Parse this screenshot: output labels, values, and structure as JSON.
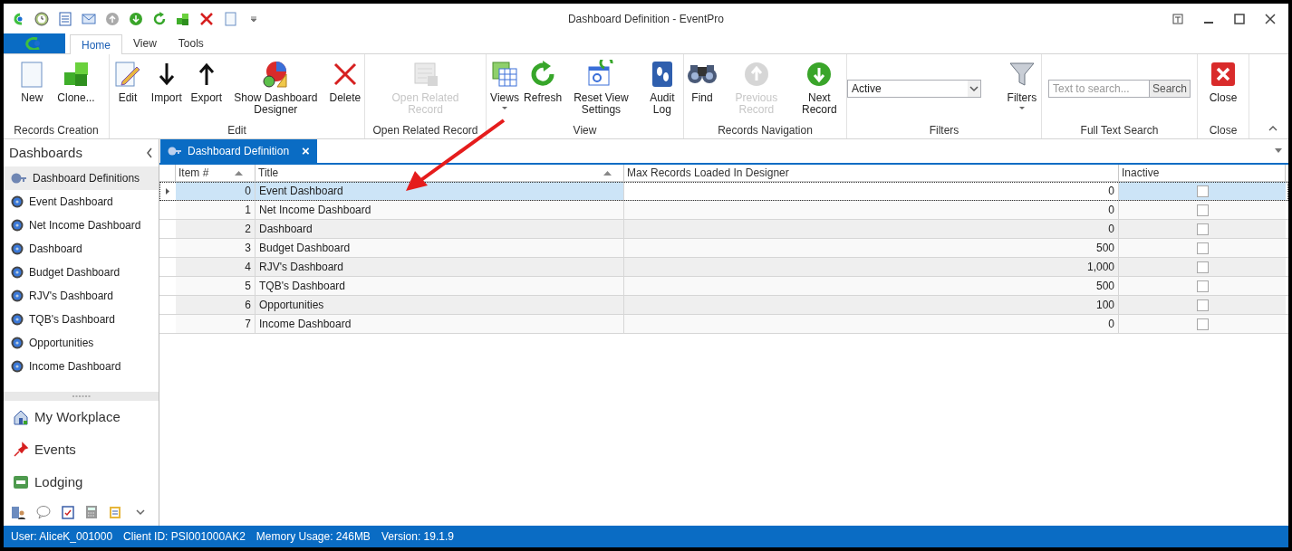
{
  "window": {
    "title": "Dashboard Definition - EventPro"
  },
  "ribbon_tabs": [
    {
      "label": "Home",
      "selected": true
    },
    {
      "label": "View",
      "selected": false
    },
    {
      "label": "Tools",
      "selected": false
    }
  ],
  "ribbon_groups": [
    {
      "label": "Records Creation",
      "buttons": [
        {
          "label": "New",
          "disabled": false
        },
        {
          "label": "Clone...",
          "disabled": false
        }
      ]
    },
    {
      "label": "Edit",
      "buttons": [
        {
          "label": "Edit",
          "disabled": false
        },
        {
          "label": "Import",
          "disabled": false
        },
        {
          "label": "Export",
          "disabled": false
        },
        {
          "label": "Show Dashboard Designer",
          "disabled": false
        },
        {
          "label": "Delete",
          "disabled": false
        }
      ]
    },
    {
      "label": "Open Related Record",
      "buttons": [
        {
          "label": "Open Related Record",
          "disabled": true
        }
      ]
    },
    {
      "label": "View",
      "buttons": [
        {
          "label": "Views",
          "disabled": false,
          "dropdown": true
        },
        {
          "label": "Refresh",
          "disabled": false
        },
        {
          "label": "Reset View Settings",
          "disabled": false
        },
        {
          "label": "Audit Log",
          "disabled": false
        }
      ]
    },
    {
      "label": "Records Navigation",
      "buttons": [
        {
          "label": "Find",
          "disabled": false
        },
        {
          "label": "Previous Record",
          "disabled": true
        },
        {
          "label": "Next Record",
          "disabled": false
        }
      ]
    },
    {
      "label": "Filters",
      "filter_value": "Active",
      "buttons": [
        {
          "label": "Filters",
          "disabled": false,
          "dropdown": true
        }
      ]
    },
    {
      "label": "Full Text Search",
      "search": {
        "placeholder": "Text to search...",
        "button": "Search"
      }
    },
    {
      "label": "Close",
      "buttons": [
        {
          "label": "Close",
          "disabled": false
        }
      ]
    }
  ],
  "sidebar": {
    "title": "Dashboards",
    "items": [
      {
        "label": "Dashboard Definitions",
        "selected": true
      },
      {
        "label": "Event Dashboard",
        "selected": false
      },
      {
        "label": "Net Income Dashboard",
        "selected": false
      },
      {
        "label": "Dashboard",
        "selected": false
      },
      {
        "label": "Budget Dashboard",
        "selected": false
      },
      {
        "label": "RJV's Dashboard",
        "selected": false
      },
      {
        "label": "TQB's Dashboard",
        "selected": false
      },
      {
        "label": "Opportunities",
        "selected": false
      },
      {
        "label": "Income Dashboard",
        "selected": false
      }
    ],
    "nav": [
      {
        "label": "My Workplace"
      },
      {
        "label": "Events"
      },
      {
        "label": "Lodging"
      }
    ]
  },
  "document_tab": {
    "label": "Dashboard Definition",
    "close": "×"
  },
  "table": {
    "columns": [
      "Item #",
      "Title",
      "Max Records Loaded In Designer",
      "Inactive"
    ],
    "rows": [
      {
        "item": "0",
        "title": "Event Dashboard",
        "max": "0",
        "inactive": false,
        "selected": true
      },
      {
        "item": "1",
        "title": "Net Income Dashboard",
        "max": "0",
        "inactive": false,
        "selected": false
      },
      {
        "item": "2",
        "title": "Dashboard",
        "max": "0",
        "inactive": false,
        "selected": false
      },
      {
        "item": "3",
        "title": "Budget Dashboard",
        "max": "500",
        "inactive": false,
        "selected": false
      },
      {
        "item": "4",
        "title": "RJV's Dashboard",
        "max": "1,000",
        "inactive": false,
        "selected": false
      },
      {
        "item": "5",
        "title": "TQB's Dashboard",
        "max": "500",
        "inactive": false,
        "selected": false
      },
      {
        "item": "6",
        "title": "Opportunities",
        "max": "100",
        "inactive": false,
        "selected": false
      },
      {
        "item": "7",
        "title": "Income Dashboard",
        "max": "0",
        "inactive": false,
        "selected": false
      }
    ]
  },
  "status_bar": [
    "User: AliceK_001000",
    "Client ID: PSI001000AK2",
    "Memory Usage: 246MB",
    "Version: 19.1.9"
  ]
}
